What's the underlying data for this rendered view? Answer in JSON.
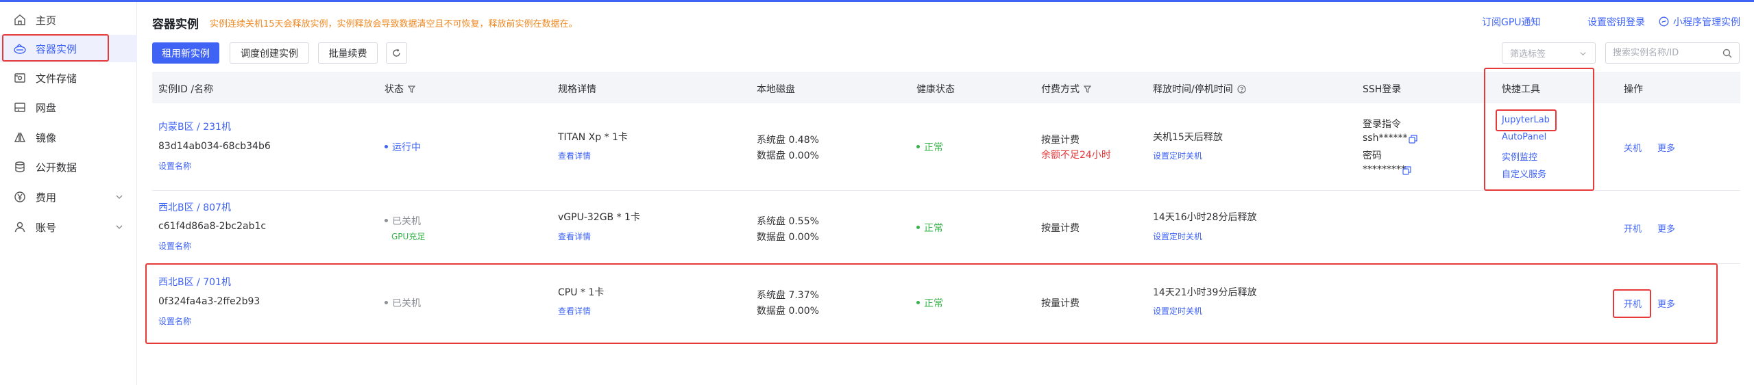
{
  "sidebar": {
    "items": [
      {
        "label": "主页",
        "icon": "home-icon"
      },
      {
        "label": "容器实例",
        "icon": "container-icon"
      },
      {
        "label": "文件存储",
        "icon": "file-storage-icon"
      },
      {
        "label": "网盘",
        "icon": "netdisk-icon"
      },
      {
        "label": "镜像",
        "icon": "image-icon"
      },
      {
        "label": "公开数据",
        "icon": "database-icon"
      },
      {
        "label": "费用",
        "icon": "yuan-icon"
      },
      {
        "label": "账号",
        "icon": "user-icon"
      }
    ]
  },
  "header": {
    "title": "容器实例",
    "warning": "实例连续关机15天会释放实例，实例释放会导致数据清空且不可恢复，释放前实例在数据在。",
    "links": [
      "订阅GPU通知",
      "设置密钥登录",
      "小程序管理实例"
    ]
  },
  "toolbar": {
    "rent_new": "租用新实例",
    "schedule_create": "调度创建实例",
    "batch_renew": "批量续费"
  },
  "filter": {
    "tag_placeholder": "筛选标签",
    "search_placeholder": "搜索实例名称/ID"
  },
  "table": {
    "headers": {
      "id_name": "实例ID /名称",
      "status": "状态",
      "spec": "规格详情",
      "disk": "本地磁盘",
      "health": "健康状态",
      "billing": "付费方式",
      "release": "释放时间/停机时间",
      "ssh": "SSH登录",
      "tools": "快捷工具",
      "actions": "操作"
    },
    "rows": [
      {
        "region": "内蒙B区 / 231机",
        "instance_id": "83d14ab034-68cb34b6",
        "set_name": "设置名称",
        "status": "运行中",
        "status_note": "",
        "spec": "TITAN Xp * 1卡",
        "spec_detail": "查看详情",
        "disk_system": "系统盘 0.48%",
        "disk_data": "数据盘 0.00%",
        "health": "正常",
        "billing": "按量计费",
        "billing_note": "余额不足24小时",
        "release": "关机15天后释放",
        "release_action": "设置定时关机",
        "ssh_cmd_label": "登录指令",
        "ssh_cmd": "ssh******",
        "ssh_pwd_label": "密码",
        "ssh_pwd": "*********",
        "tools": [
          "JupyterLab",
          "AutoPanel",
          "实例监控",
          "自定义服务"
        ],
        "action_primary": "关机",
        "action_more": "更多"
      },
      {
        "region": "西北B区 / 807机",
        "instance_id": "c61f4d86a8-2bc2ab1c",
        "set_name": "设置名称",
        "status": "已关机",
        "status_note": "GPU充足",
        "spec": "vGPU-32GB * 1卡",
        "spec_detail": "查看详情",
        "disk_system": "系统盘 0.55%",
        "disk_data": "数据盘 0.00%",
        "health": "正常",
        "billing": "按量计费",
        "billing_note": "",
        "release": "14天16小时28分后释放",
        "release_action": "设置定时关机",
        "action_primary": "开机",
        "action_more": "更多"
      },
      {
        "region": "西北B区 / 701机",
        "instance_id": "0f324fa4a3-2ffe2b93",
        "set_name": "设置名称",
        "status": "已关机",
        "status_note": "",
        "spec": "CPU * 1卡",
        "spec_detail": "查看详情",
        "disk_system": "系统盘 7.37%",
        "disk_data": "数据盘 0.00%",
        "health": "正常",
        "billing": "按量计费",
        "billing_note": "",
        "release": "14天21小时39分后释放",
        "release_action": "设置定时关机",
        "action_primary": "开机",
        "action_more": "更多"
      }
    ]
  },
  "colors": {
    "primary": "#3f63f5",
    "warning": "#f08a24",
    "success": "#36b34a",
    "danger": "#e6393a",
    "highlight_box": "#e6393a"
  }
}
